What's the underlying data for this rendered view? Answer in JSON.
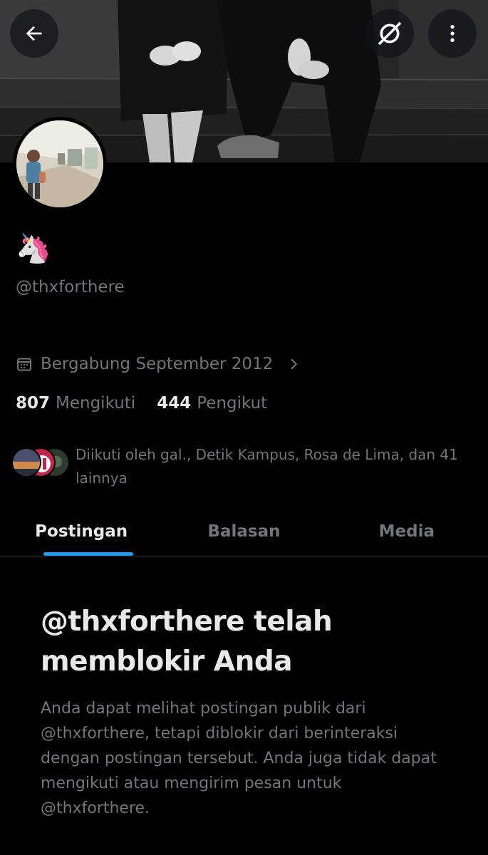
{
  "header": {
    "back_icon": "arrow-left-icon",
    "grok_icon": "grok-icon",
    "more_icon": "more-vertical-icon"
  },
  "profile": {
    "display_name": "🦄",
    "handle": "@thxforthere",
    "joined": "Bergabung September 2012",
    "following_count": "807",
    "following_label": "Mengikuti",
    "followers_count": "444",
    "followers_label": "Pengikut",
    "followed_by_text": "Diikuti oleh gal., Detik Kampus, Rosa de Lima, dan 41 lainnya"
  },
  "tabs": [
    {
      "label": "Postingan",
      "active": true
    },
    {
      "label": "Balasan",
      "active": false
    },
    {
      "label": "Media",
      "active": false
    }
  ],
  "blocked": {
    "title": "@thxforthere telah memblokir Anda",
    "description": "Anda dapat melihat postingan publik dari @thxforthere, tetapi diblokir dari berinteraksi dengan postingan tersebut. Anda juga tidak dapat mengikuti atau mengirim pesan untuk @thxforthere."
  },
  "colors": {
    "background": "#000000",
    "text_primary": "#e7e9ea",
    "text_secondary": "#71767b",
    "accent": "#1d9bf0",
    "divider": "#2f3336"
  }
}
